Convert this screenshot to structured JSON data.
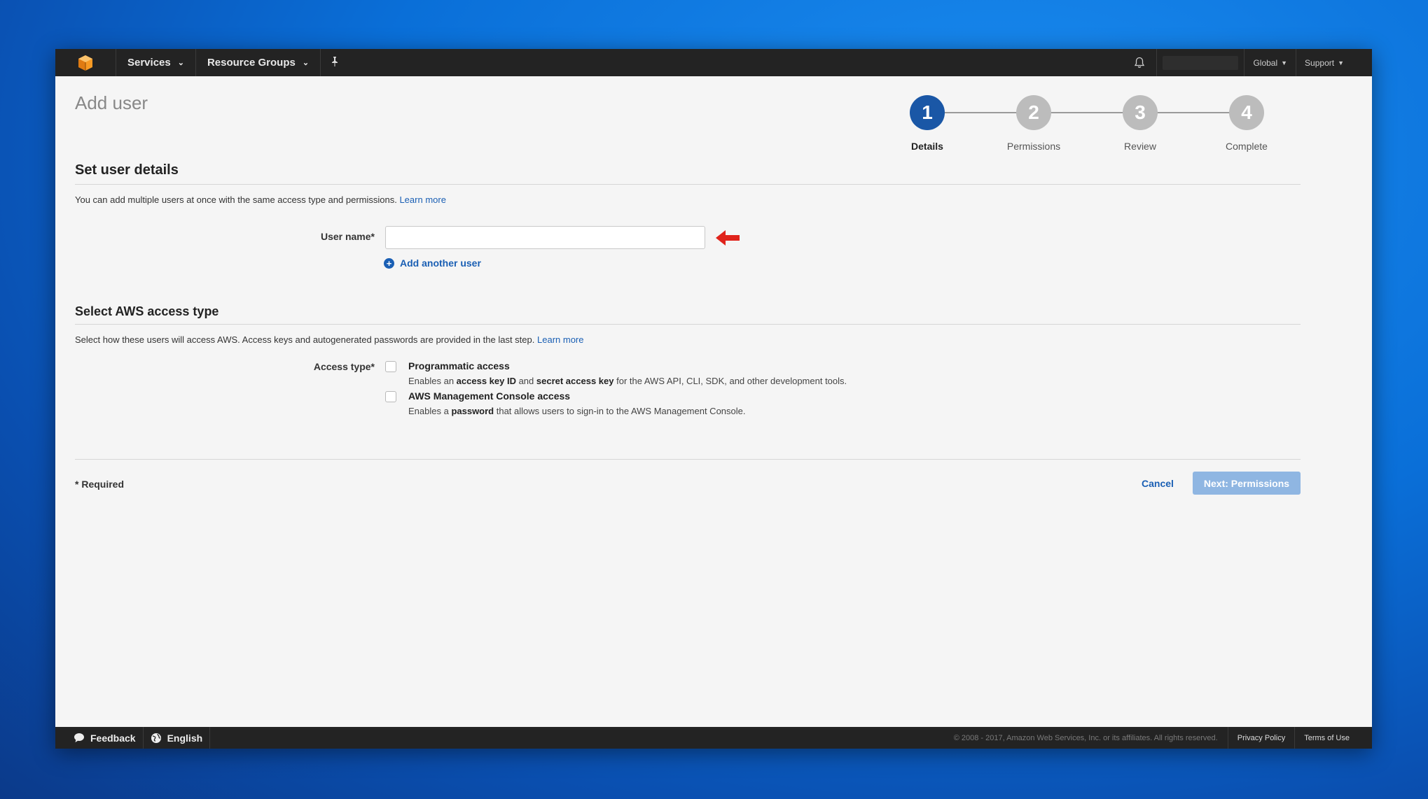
{
  "topnav": {
    "logo_icon": "aws-cube-icon",
    "services_label": "Services",
    "resource_groups_label": "Resource Groups",
    "pin_icon": "pin-icon",
    "bell_icon": "bell-icon",
    "region_label": "Global",
    "support_label": "Support"
  },
  "page": {
    "title": "Add user"
  },
  "wizard": {
    "steps": [
      {
        "number": "1",
        "label": "Details"
      },
      {
        "number": "2",
        "label": "Permissions"
      },
      {
        "number": "3",
        "label": "Review"
      },
      {
        "number": "4",
        "label": "Complete"
      }
    ],
    "active_step": 1,
    "active_color": "#1a57a6",
    "inactive_color": "#bcbcbc"
  },
  "user_details": {
    "title": "Set user details",
    "description": "You can add multiple users at once with the same access type and permissions.",
    "learn_more": "Learn more",
    "username_label": "User name*",
    "username_value": "",
    "add_another_label": "Add another user"
  },
  "access_type": {
    "title": "Select AWS access type",
    "description": "Select how these users will access AWS. Access keys and autogenerated passwords are provided in the last step.",
    "learn_more": "Learn more",
    "label": "Access type*",
    "options": [
      {
        "title": "Programmatic access",
        "sub_prefix": "Enables an ",
        "bold1": "access key ID",
        "mid": " and ",
        "bold2": "secret access key",
        "sub_suffix": " for the AWS API, CLI, SDK, and other development tools.",
        "checked": false
      },
      {
        "title": "AWS Management Console access",
        "sub_prefix": "Enables a ",
        "bold1": "password",
        "sub_suffix": " that allows users to sign-in to the AWS Management Console.",
        "checked": false
      }
    ]
  },
  "actions": {
    "required_note": "* Required",
    "cancel_label": "Cancel",
    "next_label": "Next: Permissions"
  },
  "footer": {
    "feedback_label": "Feedback",
    "language_label": "English",
    "copyright": "© 2008 - 2017, Amazon Web Services, Inc. or its affiliates. All rights reserved.",
    "privacy_label": "Privacy Policy",
    "terms_label": "Terms of Use"
  },
  "colors": {
    "link": "#1a5fb4",
    "annotation_arrow": "#e0231b",
    "nav_bg": "#232323"
  }
}
